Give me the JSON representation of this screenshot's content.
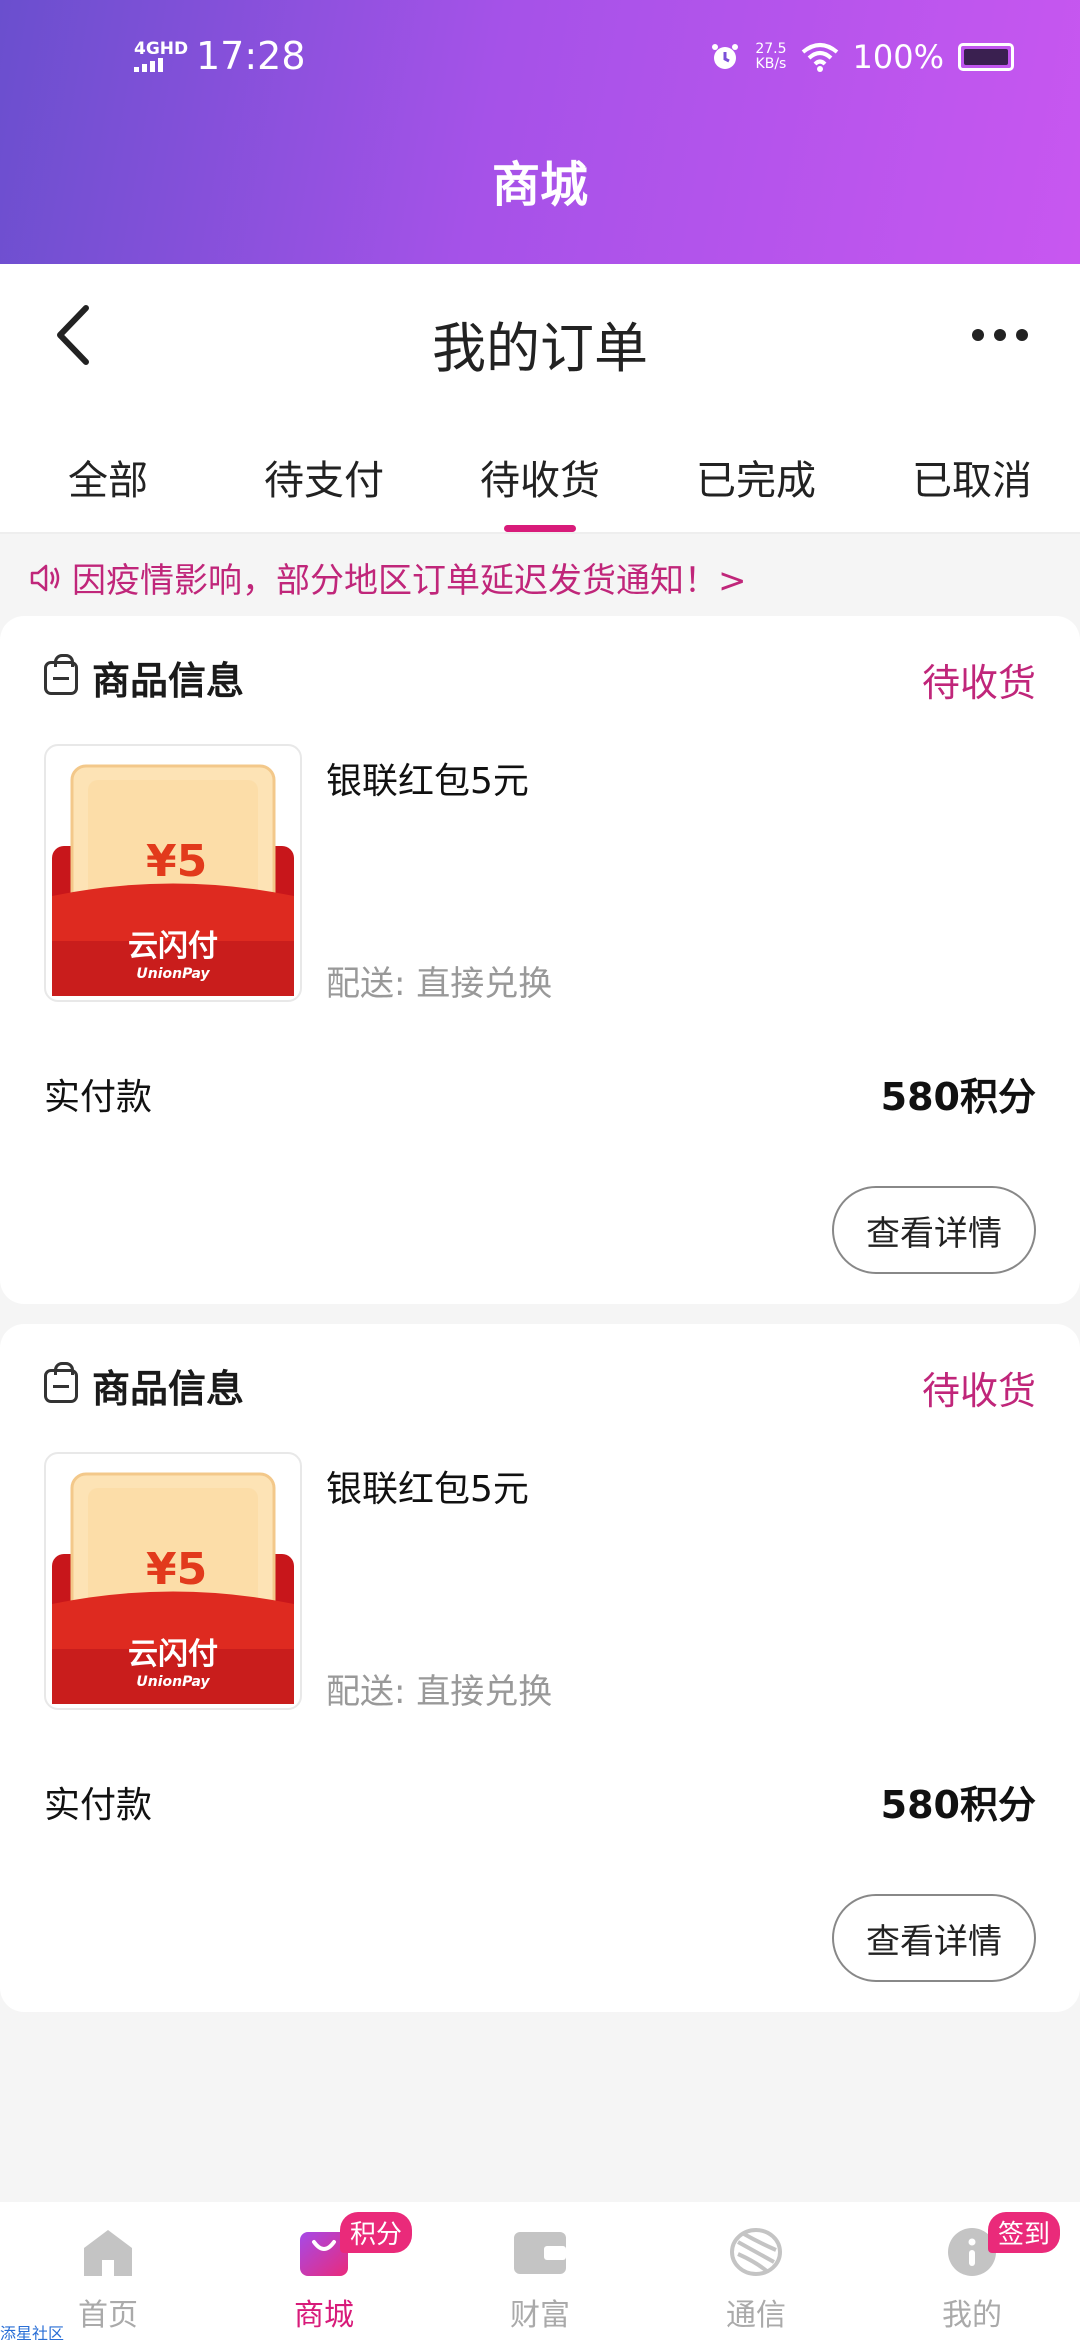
{
  "status_bar": {
    "network": "4GHD",
    "time": "17:28",
    "speed_value": "27.5",
    "speed_unit": "KB/s",
    "battery": "100%"
  },
  "app": {
    "title": "商城"
  },
  "nav": {
    "page_title": "我的订单"
  },
  "tabs": [
    {
      "label": "全部",
      "active": false
    },
    {
      "label": "待支付",
      "active": false
    },
    {
      "label": "待收货",
      "active": true
    },
    {
      "label": "已完成",
      "active": false
    },
    {
      "label": "已取消",
      "active": false
    }
  ],
  "notice": {
    "text": "因疫情影响，部分地区订单延迟发货通知！>"
  },
  "orders": [
    {
      "header": "商品信息",
      "status": "待收货",
      "product_name": "银联红包5元",
      "delivery": "配送: 直接兑换",
      "pay_label": "实付款",
      "pay_value": "580积分",
      "detail_button": "查看详情",
      "image": {
        "amount": "¥5",
        "brand": "云闪付",
        "brand_en": "UnionPay"
      }
    },
    {
      "header": "商品信息",
      "status": "待收货",
      "product_name": "银联红包5元",
      "delivery": "配送: 直接兑换",
      "pay_label": "实付款",
      "pay_value": "580积分",
      "detail_button": "查看详情",
      "image": {
        "amount": "¥5",
        "brand": "云闪付",
        "brand_en": "UnionPay"
      }
    }
  ],
  "bottom_nav": [
    {
      "label": "首页",
      "icon": "home-icon",
      "badge": ""
    },
    {
      "label": "商城",
      "icon": "shopping-bag-icon",
      "badge": "积分"
    },
    {
      "label": "财富",
      "icon": "wallet-icon",
      "badge": ""
    },
    {
      "label": "通信",
      "icon": "china-mobile-icon",
      "badge": ""
    },
    {
      "label": "我的",
      "icon": "profile-icon",
      "badge": "签到"
    }
  ],
  "watermark": "添星社区",
  "colors": {
    "accent": "#d81b7a",
    "status_pink": "#c0267a",
    "header_start": "#6a4fce",
    "header_end": "#c857f0",
    "envelope_red": "#d8201c"
  }
}
